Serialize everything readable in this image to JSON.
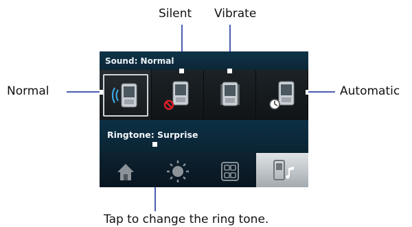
{
  "screen": {
    "status_label": "Sound: Normal",
    "ringtone_label": "Ringtone: Surprise"
  },
  "modes": [
    {
      "name": "Normal",
      "icon": "phone-with-sound-waves-icon",
      "selected": true
    },
    {
      "name": "Silent",
      "icon": "phone-with-no-sound-icon",
      "selected": false
    },
    {
      "name": "Vibrate",
      "icon": "phone-vibrate-icon",
      "selected": false
    },
    {
      "name": "Automatic",
      "icon": "phone-with-clock-icon",
      "selected": false
    }
  ],
  "tabs": [
    {
      "icon": "home-icon",
      "active": false
    },
    {
      "icon": "sun-icon",
      "active": false
    },
    {
      "icon": "grid-icon",
      "active": false
    },
    {
      "icon": "phone-music-icon",
      "active": true
    }
  ],
  "callouts": {
    "normal": "Normal",
    "silent": "Silent",
    "vibrate": "Vibrate",
    "automatic": "Automatic",
    "ringtone": "Tap to change the ring tone."
  },
  "colors": {
    "callout_line": "#4a5db0",
    "screen_bg": "#0d2a3c",
    "active_tab": "#dfe3e6"
  }
}
